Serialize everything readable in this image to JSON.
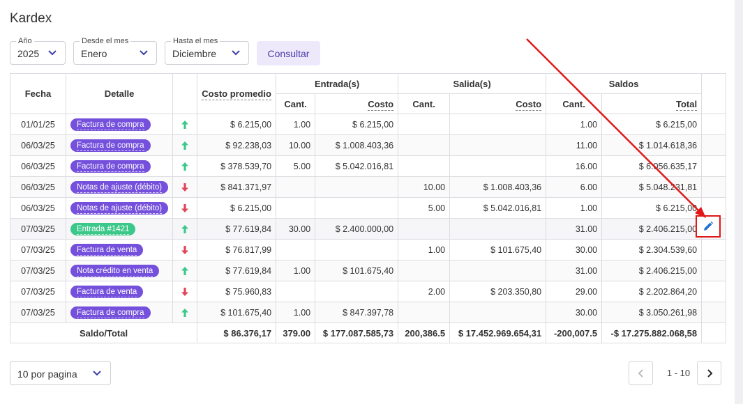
{
  "title": "Kardex",
  "filters": {
    "year": {
      "label": "Año",
      "value": "2025"
    },
    "from_month": {
      "label": "Desde el mes",
      "value": "Enero"
    },
    "to_month": {
      "label": "Hasta el mes",
      "value": "Diciembre"
    },
    "consult_label": "Consultar"
  },
  "table": {
    "headers": {
      "fecha": "Fecha",
      "detalle": "Detalle",
      "costo_promedio": "Costo promedio",
      "entradas": "Entrada(s)",
      "salidas": "Salida(s)",
      "saldos": "Saldos",
      "cant": "Cant.",
      "costo": "Costo",
      "total": "Total"
    },
    "rows": [
      {
        "fecha": "01/01/25",
        "detalle": "Factura de compra",
        "badge_color": "purple",
        "dir": "up",
        "costo_promedio": "$ 6.215,00",
        "entrada_cant": "1.00",
        "entrada_costo": "$ 6.215,00",
        "salida_cant": "",
        "salida_costo": "",
        "saldo_cant": "1.00",
        "saldo_total": "$ 6.215,00"
      },
      {
        "fecha": "06/03/25",
        "detalle": "Factura de compra",
        "badge_color": "purple",
        "dir": "up",
        "costo_promedio": "$ 92.238,03",
        "entrada_cant": "10.00",
        "entrada_costo": "$ 1.008.403,36",
        "salida_cant": "",
        "salida_costo": "",
        "saldo_cant": "11.00",
        "saldo_total": "$ 1.014.618,36"
      },
      {
        "fecha": "06/03/25",
        "detalle": "Factura de compra",
        "badge_color": "purple",
        "dir": "up",
        "costo_promedio": "$ 378.539,70",
        "entrada_cant": "5.00",
        "entrada_costo": "$ 5.042.016,81",
        "salida_cant": "",
        "salida_costo": "",
        "saldo_cant": "16.00",
        "saldo_total": "$ 6.056.635,17"
      },
      {
        "fecha": "06/03/25",
        "detalle": "Notas de ajuste (débito)",
        "badge_color": "purple",
        "dir": "down",
        "costo_promedio": "$ 841.371,97",
        "entrada_cant": "",
        "entrada_costo": "",
        "salida_cant": "10.00",
        "salida_costo": "$ 1.008.403,36",
        "saldo_cant": "6.00",
        "saldo_total": "$ 5.048.231,81"
      },
      {
        "fecha": "06/03/25",
        "detalle": "Notas de ajuste (débito)",
        "badge_color": "purple",
        "dir": "down",
        "costo_promedio": "$ 6.215,00",
        "entrada_cant": "",
        "entrada_costo": "",
        "salida_cant": "5.00",
        "salida_costo": "$ 5.042.016,81",
        "saldo_cant": "1.00",
        "saldo_total": "$ 6.215,00"
      },
      {
        "fecha": "07/03/25",
        "detalle": "Entrada #1421",
        "badge_color": "green",
        "dir": "up",
        "costo_promedio": "$ 77.619,84",
        "entrada_cant": "30.00",
        "entrada_costo": "$ 2.400.000,00",
        "salida_cant": "",
        "salida_costo": "",
        "saldo_cant": "31.00",
        "saldo_total": "$ 2.406.215,00"
      },
      {
        "fecha": "07/03/25",
        "detalle": "Factura de venta",
        "badge_color": "purple",
        "dir": "down",
        "costo_promedio": "$ 76.817,99",
        "entrada_cant": "",
        "entrada_costo": "",
        "salida_cant": "1.00",
        "salida_costo": "$ 101.675,40",
        "saldo_cant": "30.00",
        "saldo_total": "$ 2.304.539,60"
      },
      {
        "fecha": "07/03/25",
        "detalle": "Nota crédito en venta",
        "badge_color": "purple",
        "dir": "up",
        "costo_promedio": "$ 77.619,84",
        "entrada_cant": "1.00",
        "entrada_costo": "$ 101.675,40",
        "salida_cant": "",
        "salida_costo": "",
        "saldo_cant": "31.00",
        "saldo_total": "$ 2.406.215,00"
      },
      {
        "fecha": "07/03/25",
        "detalle": "Factura de venta",
        "badge_color": "purple",
        "dir": "down",
        "costo_promedio": "$ 75.960,83",
        "entrada_cant": "",
        "entrada_costo": "",
        "salida_cant": "2.00",
        "salida_costo": "$ 203.350,80",
        "saldo_cant": "29.00",
        "saldo_total": "$ 2.202.864,20"
      },
      {
        "fecha": "07/03/25",
        "detalle": "Factura de compra",
        "badge_color": "purple",
        "dir": "up",
        "costo_promedio": "$ 101.675,40",
        "entrada_cant": "1.00",
        "entrada_costo": "$ 847.397,78",
        "salida_cant": "",
        "salida_costo": "",
        "saldo_cant": "30.00",
        "saldo_total": "$ 3.050.261,98"
      }
    ],
    "footer": {
      "label": "Saldo/Total",
      "costo_promedio": "$ 86.376,17",
      "entrada_cant": "379.00",
      "entrada_costo": "$ 177.087.585,73",
      "salida_cant": "200,386.5",
      "salida_costo": "$ 17.452.969.654,31",
      "saldo_cant": "-200,007.5",
      "saldo_total": "-$ 17.275.882.068,58"
    }
  },
  "pagination": {
    "per_page": "10 por pagina",
    "range": "1 - 10"
  },
  "colors": {
    "badge_purple": "#7450dc",
    "badge_green": "#3cc88a",
    "arrow_up": "#3cc88a",
    "arrow_down": "#e0455a",
    "annotation_red": "#e01818",
    "edit_icon": "#1f6fd0"
  },
  "icons": {
    "edit": "pencil-icon",
    "up": "arrow-up-icon",
    "down": "arrow-down-icon",
    "prev": "chevron-left-icon",
    "next": "chevron-right-icon",
    "select": "chevron-down-icon"
  }
}
